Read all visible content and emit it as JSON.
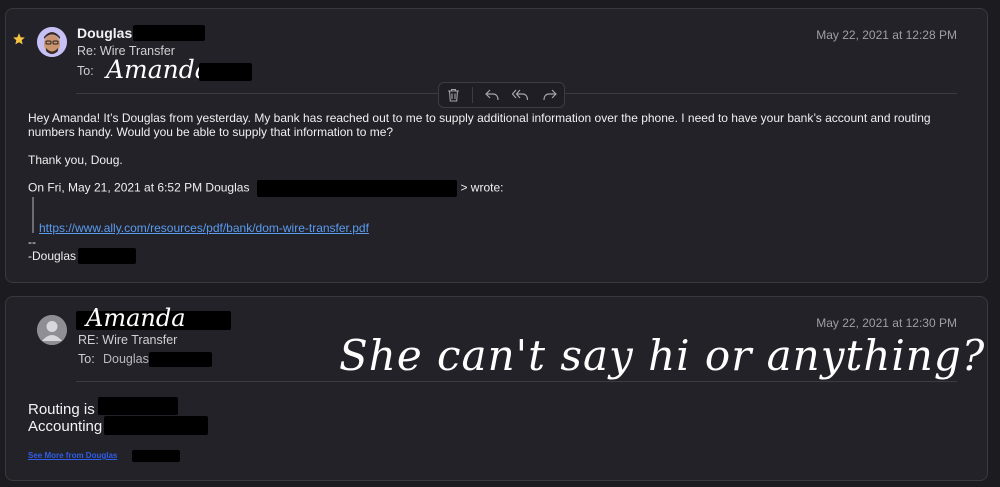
{
  "message1": {
    "starred": true,
    "sender": "Douglas",
    "subject": "Re: Wire Transfer",
    "to_label": "To:",
    "to_name_handwritten": "Amanda",
    "date": "May 22, 2021 at 12:28 PM",
    "body_para1": "Hey Amanda! It’s Douglas from yesterday. My bank has reached out to me to supply additional information over the phone. I need to have your bank’s account and routing numbers handy. Would you be able to supply that information to me?",
    "body_para2": "Thank you, Doug.",
    "quote_prefix": "On Fri, May 21, 2021 at 6:52 PM Douglas",
    "quote_suffix": "> wrote:",
    "quoted_link": "https://www.ally.com/resources/pdf/bank/dom-wire-transfer.pdf",
    "sig_dash": "--",
    "sig_name": "-Douglas"
  },
  "message2": {
    "sender_handwritten": "Amanda",
    "subject": "RE: Wire Transfer",
    "to_label": "To:",
    "to_name": "Douglas",
    "date": "May 22, 2021 at 12:30 PM",
    "routing_label": "Routing is",
    "accounting_label": "Accounting",
    "see_more": "See More from Douglas",
    "annotation": "She can't say hi or anything?"
  },
  "colors": {
    "background": "#1c1b20",
    "panel": "#232228",
    "link": "#5a9cf0",
    "star": "#f5c242",
    "redaction": "#000000"
  },
  "icons": [
    "star-icon",
    "memoji-avatar",
    "person-avatar",
    "trash-icon",
    "reply-icon",
    "reply-all-icon",
    "forward-icon"
  ]
}
